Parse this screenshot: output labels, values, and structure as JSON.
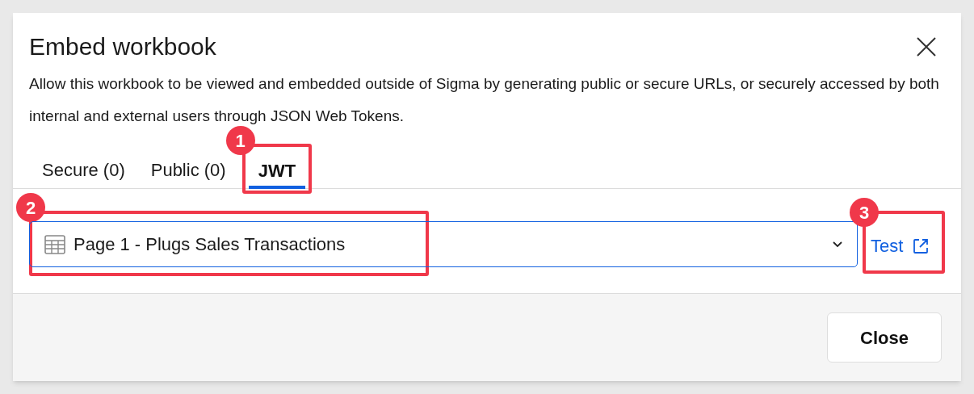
{
  "dialog": {
    "title": "Embed workbook",
    "description": "Allow this workbook to be viewed and embedded outside of Sigma by generating public or secure URLs, or securely accessed by both internal and external users through JSON Web Tokens.",
    "tabs": [
      {
        "label": "Secure (0)",
        "selected": false
      },
      {
        "label": "Public (0)",
        "selected": false
      },
      {
        "label": "JWT",
        "selected": true
      }
    ],
    "page_select": {
      "value": "Page 1 - Plugs Sales Transactions"
    },
    "test_link": "Test",
    "buttons": [
      "Close"
    ]
  },
  "annotations": [
    {
      "label": "1"
    },
    {
      "label": "2"
    },
    {
      "label": "3"
    }
  ]
}
